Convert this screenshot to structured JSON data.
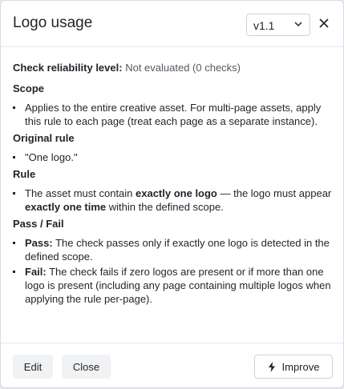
{
  "dialog": {
    "title": "Logo usage",
    "version": "v1.1",
    "icons": {
      "version_chevron": "chevron-down-icon",
      "close": "close-icon",
      "improve": "bolt-icon"
    }
  },
  "reliability": {
    "label": "Check reliability level:",
    "value": "Not evaluated (0 checks)"
  },
  "scope": {
    "title": "Scope",
    "items": [
      "Applies to the entire creative asset. For multi-page assets, apply this rule to each page (treat each page as a separate instance)."
    ]
  },
  "original_rule": {
    "title": "Original rule",
    "items": [
      "\"One logo.\""
    ]
  },
  "rule": {
    "title": "Rule",
    "p1": "The asset must contain ",
    "b1": "exactly one logo",
    "p2": " — the logo must appear ",
    "b2": "exactly one time",
    "p3": " within the defined scope."
  },
  "pass_fail": {
    "title": "Pass / Fail",
    "pass_label": "Pass:",
    "pass_text": " The check passes only if exactly one logo is detected in the defined scope.",
    "fail_label": "Fail:",
    "fail_text": " The check fails if zero logos are present or if more than one logo is present (including any page containing multiple logos when applying the rule per-page)."
  },
  "footer": {
    "edit": "Edit",
    "close": "Close",
    "improve": "Improve"
  }
}
